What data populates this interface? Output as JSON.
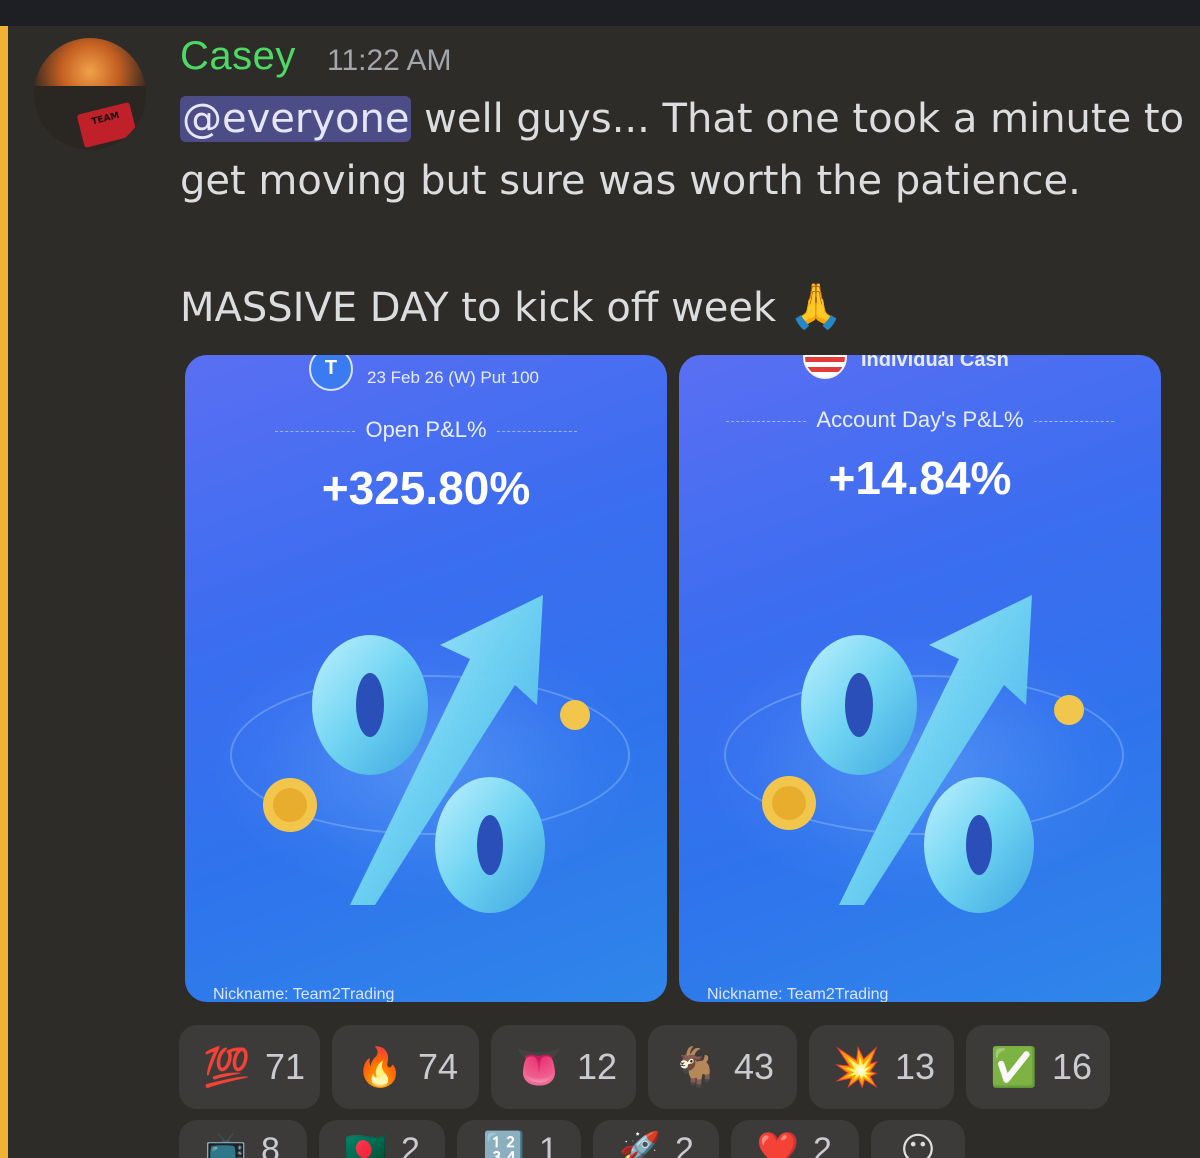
{
  "message": {
    "author": "Casey",
    "timestamp": "11:22 AM",
    "mention": "@everyone",
    "line1_rest": " well guys... That one took a minute to",
    "line2": "get moving but sure was worth the patience.",
    "line3": "MASSIVE DAY to kick off week",
    "pray_emoji": "🙏",
    "avatar_badge": "TEAM"
  },
  "cards": [
    {
      "top_small": "23 Feb 26 (W) Put 100",
      "metric_label": "Open P&L%",
      "metric_value": "+325.80%",
      "nickname": "Nickname: Team2Trading",
      "icon": "ticker-icon",
      "icon_glyph": "T"
    },
    {
      "top_small": "Individual Cash",
      "metric_label": "Account Day's P&L%",
      "metric_value": "+14.84%",
      "nickname": "Nickname: Team2Trading",
      "icon": "us-flag-icon"
    }
  ],
  "reactions": [
    {
      "emoji": "💯",
      "count": "71",
      "icon": "hundred-icon"
    },
    {
      "emoji": "🔥",
      "count": "74",
      "icon": "fire-icon"
    },
    {
      "emoji": "👅",
      "count": "12",
      "icon": "tongue-icon"
    },
    {
      "emoji": "🐐",
      "count": "43",
      "icon": "goat-icon"
    },
    {
      "emoji": "💥",
      "count": "13",
      "icon": "collision-icon"
    },
    {
      "emoji": "✅",
      "count": "16",
      "icon": "check-icon"
    }
  ],
  "reactions_row2": [
    {
      "emoji": "📺",
      "count": "8",
      "icon": "tv-icon"
    },
    {
      "emoji": "🇧🇩",
      "count": "2",
      "icon": "flag-icon"
    },
    {
      "emoji": "🔢",
      "count": "1",
      "icon": "numbers-icon"
    },
    {
      "emoji": "🚀",
      "count": "2",
      "icon": "rocket-icon"
    },
    {
      "emoji": "❤️",
      "count": "2",
      "icon": "heart-icon"
    },
    {
      "emoji": "😶",
      "count": "",
      "icon": "add-reaction-icon"
    }
  ],
  "colors": {
    "mention_bar": "#f0b232",
    "author": "#4cd964",
    "mention_bg": "#4c4d86"
  }
}
